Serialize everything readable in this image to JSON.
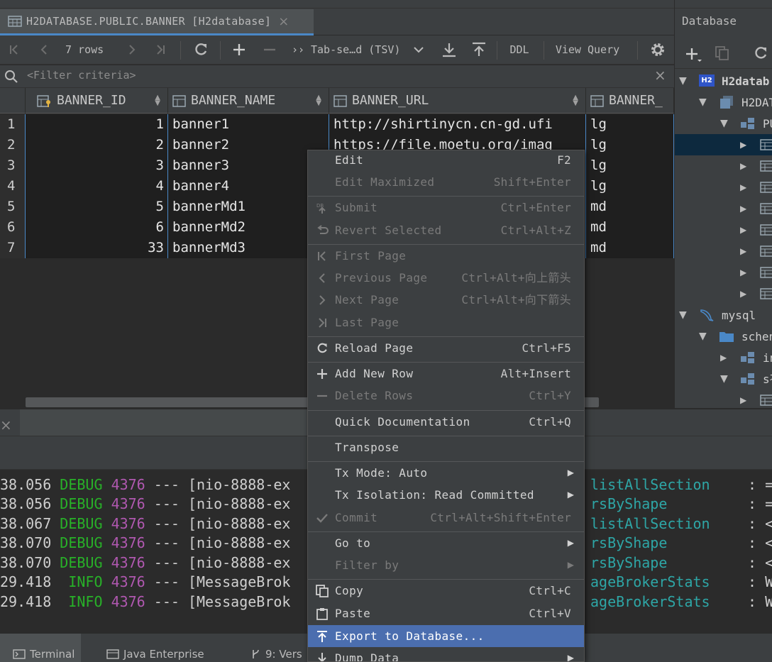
{
  "editor_tab": {
    "title": "H2DATABASE.PUBLIC.BANNER [H2database]",
    "close": "×"
  },
  "toolbar": {
    "rows_label": "7 rows",
    "format_label": "Tab-se…d (TSV)",
    "more": "››",
    "ddl_label": "DDL",
    "view_query_label": "View Query"
  },
  "filter": {
    "placeholder": "<Filter criteria>",
    "clear": "×"
  },
  "grid": {
    "columns": [
      "BANNER_ID",
      "BANNER_NAME",
      "BANNER_URL",
      "BANNER_"
    ],
    "rows": [
      {
        "num": "1",
        "id": "1",
        "name": "banner1",
        "url": "http://shirtinycn.cn-gd.ufi",
        "type": "lg"
      },
      {
        "num": "2",
        "id": "2",
        "name": "banner2",
        "url": "https://file.moetu.org/imag",
        "type": "lg"
      },
      {
        "num": "3",
        "id": "3",
        "name": "banner3",
        "url": "",
        "type": "lg"
      },
      {
        "num": "4",
        "id": "4",
        "name": "banner4",
        "url": "",
        "type": "lg"
      },
      {
        "num": "5",
        "id": "5",
        "name": "bannerMd1",
        "url": "",
        "type": "md"
      },
      {
        "num": "6",
        "id": "6",
        "name": "bannerMd2",
        "url": "",
        "type": "md"
      },
      {
        "num": "7",
        "id": "33",
        "name": "bannerMd3",
        "url": "",
        "type": "md"
      }
    ]
  },
  "db_panel": {
    "title": "Database",
    "tree": [
      {
        "label": "H2datab",
        "badge": "H2"
      },
      {
        "label": "H2DAT"
      },
      {
        "label": "PU"
      },
      {
        "label": ""
      },
      {
        "label": ""
      },
      {
        "label": ""
      },
      {
        "label": ""
      },
      {
        "label": ""
      },
      {
        "label": ""
      },
      {
        "label": ""
      },
      {
        "label": ""
      },
      {
        "label": "mysql"
      },
      {
        "label": "schen"
      },
      {
        "label": "in"
      },
      {
        "label": "sł"
      },
      {
        "label": ""
      }
    ]
  },
  "context_menu": {
    "items": [
      {
        "label": "Edit",
        "shortcut": "F2"
      },
      {
        "label": "Edit Maximized",
        "shortcut": "Shift+Enter"
      },
      {
        "label": "Submit",
        "shortcut": "Ctrl+Enter"
      },
      {
        "label": "Revert Selected",
        "shortcut": "Ctrl+Alt+Z"
      },
      {
        "label": "First Page",
        "shortcut": ""
      },
      {
        "label": "Previous Page",
        "shortcut": "Ctrl+Alt+向上箭头"
      },
      {
        "label": "Next Page",
        "shortcut": "Ctrl+Alt+向下箭头"
      },
      {
        "label": "Last Page",
        "shortcut": ""
      },
      {
        "label": "Reload Page",
        "shortcut": "Ctrl+F5"
      },
      {
        "label": "Add New Row",
        "shortcut": "Alt+Insert"
      },
      {
        "label": "Delete Rows",
        "shortcut": "Ctrl+Y"
      },
      {
        "label": "Quick Documentation",
        "shortcut": "Ctrl+Q"
      },
      {
        "label": "Transpose",
        "shortcut": ""
      },
      {
        "label": "Tx Mode: Auto",
        "shortcut": ""
      },
      {
        "label": "Tx Isolation: Read Committed",
        "shortcut": ""
      },
      {
        "label": "Commit",
        "shortcut": "Ctrl+Alt+Shift+Enter"
      },
      {
        "label": "Go to",
        "shortcut": ""
      },
      {
        "label": "Filter by",
        "shortcut": ""
      },
      {
        "label": "Copy",
        "shortcut": "Ctrl+C"
      },
      {
        "label": "Paste",
        "shortcut": "Ctrl+V"
      },
      {
        "label": "Export to Database...",
        "shortcut": ""
      },
      {
        "label": "Dump Data",
        "shortcut": ""
      }
    ]
  },
  "console": {
    "lines": [
      {
        "time": "38.056",
        "level": "DEBUG",
        "pid": "4376",
        "sep": "---",
        "thread": "[nio-8888-ex",
        "logger": "listAllSection",
        "tail": ": ="
      },
      {
        "time": "38.056",
        "level": "DEBUG",
        "pid": "4376",
        "sep": "---",
        "thread": "[nio-8888-ex",
        "logger": "rsByShape",
        "tail": ": ="
      },
      {
        "time": "38.067",
        "level": "DEBUG",
        "pid": "4376",
        "sep": "---",
        "thread": "[nio-8888-ex",
        "logger": "listAllSection",
        "tail": ": <"
      },
      {
        "time": "38.070",
        "level": "DEBUG",
        "pid": "4376",
        "sep": "---",
        "thread": "[nio-8888-ex",
        "logger": "rsByShape",
        "tail": ": <"
      },
      {
        "time": "38.070",
        "level": "DEBUG",
        "pid": "4376",
        "sep": "---",
        "thread": "[nio-8888-ex",
        "logger": "rsByShape",
        "tail": ": <"
      },
      {
        "time": "29.418",
        "level": "INFO",
        "pid": "4376",
        "sep": "---",
        "thread": "[MessageBrok",
        "logger": "ageBrokerStats",
        "tail": ": W"
      },
      {
        "time": "29.418",
        "level": "INFO",
        "pid": "4376",
        "sep": "---",
        "thread": "[MessageBrok",
        "logger": "ageBrokerStats",
        "tail": ": W"
      }
    ]
  },
  "bottom_tabs": {
    "terminal": "Terminal",
    "java_enterprise": "Java Enterprise",
    "version": "9: Vers"
  },
  "colors": {
    "accent": "#4a88c7",
    "menu_highlight": "#4b6eaf",
    "debug": "#28b128",
    "pid": "#b058b0",
    "logger": "#2ea6a6"
  }
}
